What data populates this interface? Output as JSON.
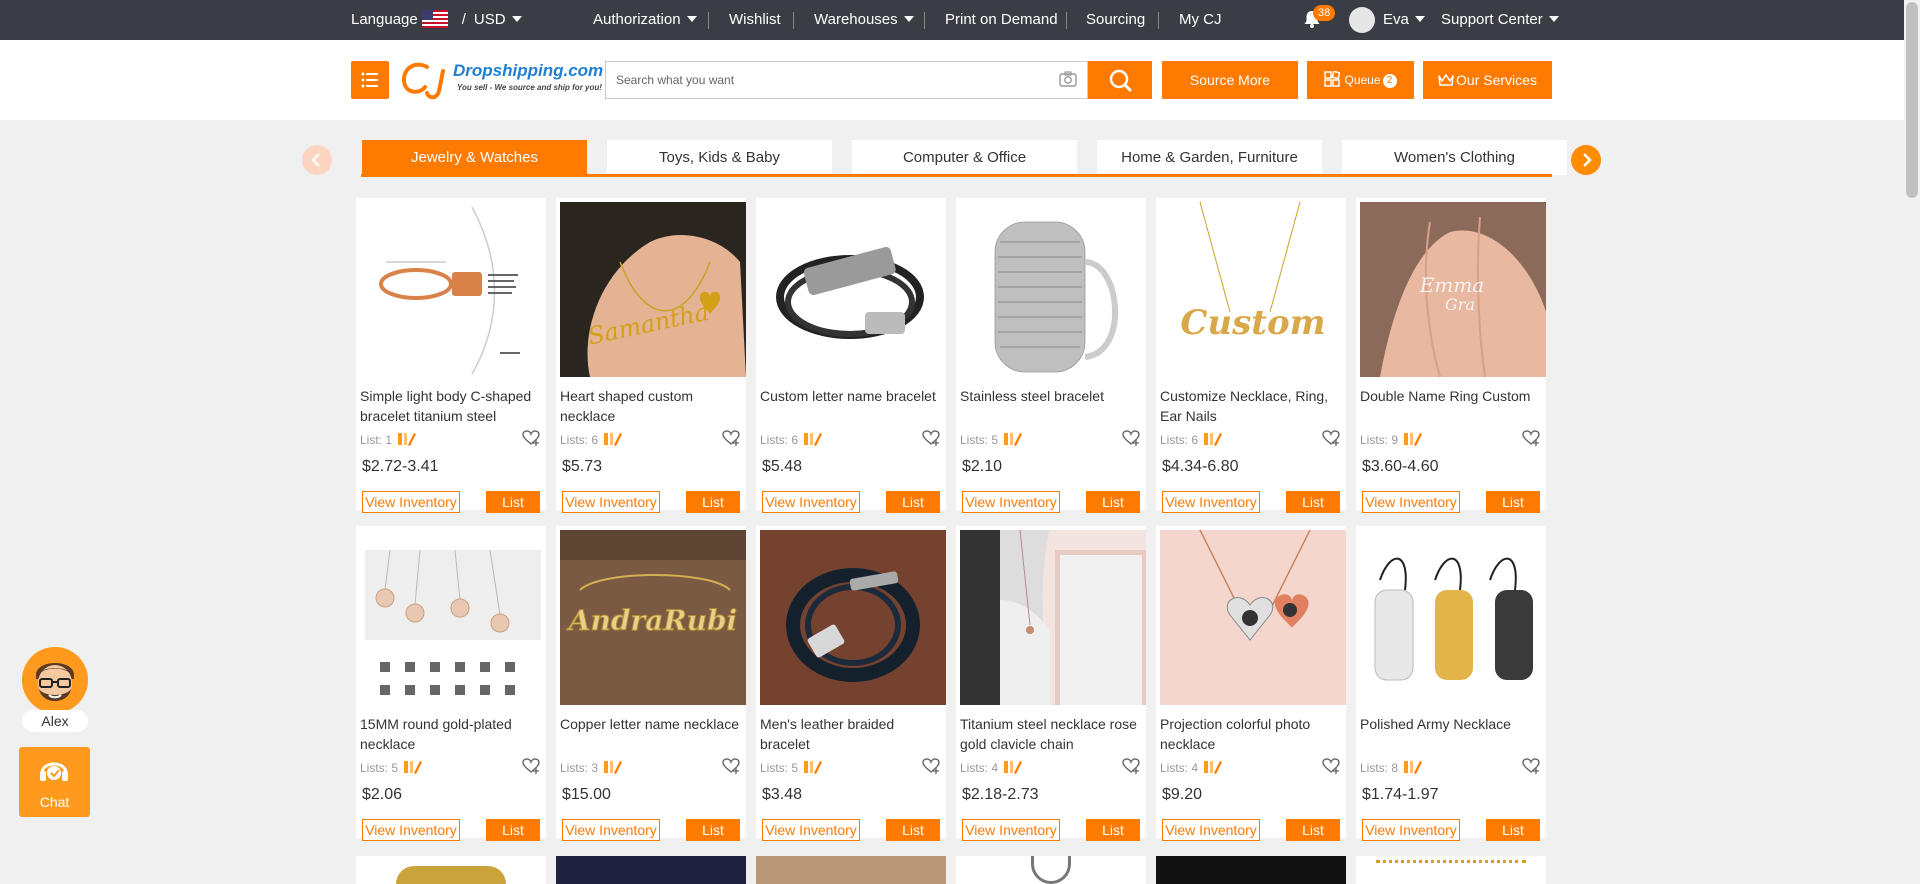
{
  "topbar": {
    "language_label": "Language",
    "slash": "/",
    "currency": "USD",
    "nav": [
      "Authorization",
      "Wishlist",
      "Warehouses",
      "Print on Demand",
      "Sourcing",
      "My CJ"
    ],
    "notification_count": "38",
    "user_name": "Eva",
    "support_center": "Support Center"
  },
  "header": {
    "logo_text": "Dropshipping.com",
    "logo_tagline": "You sell - We source and ship for you!",
    "search_placeholder": "Search what you want",
    "source_more": "Source More",
    "queue_label": "Queue",
    "queue_count": "2",
    "our_services": "Our Services"
  },
  "categories": [
    {
      "label": "Jewelry & Watches",
      "active": true
    },
    {
      "label": "Toys, Kids & Baby",
      "active": false
    },
    {
      "label": "Computer & Office",
      "active": false
    },
    {
      "label": "Home & Garden, Furniture",
      "active": false
    },
    {
      "label": "Women's Clothing",
      "active": false
    }
  ],
  "products": [
    {
      "title": "Simple light body C-shaped bracelet titanium steel",
      "lists": "List: 1",
      "price": "$2.72-3.41"
    },
    {
      "title": "Heart shaped custom necklace",
      "lists": "Lists: 6",
      "price": "$5.73"
    },
    {
      "title": "Custom letter name bracelet",
      "lists": "Lists: 6",
      "price": "$5.48"
    },
    {
      "title": "Stainless steel bracelet",
      "lists": "Lists: 5",
      "price": "$2.10"
    },
    {
      "title": "Customize Necklace, Ring, Ear Nails",
      "lists": "Lists: 6",
      "price": "$4.34-6.80"
    },
    {
      "title": "Double Name Ring Custom",
      "lists": "Lists: 9",
      "price": "$3.60-4.60"
    },
    {
      "title": "15MM round gold-plated necklace",
      "lists": "Lists: 5",
      "price": "$2.06"
    },
    {
      "title": "Copper letter name necklace",
      "lists": "Lists: 3",
      "price": "$15.00"
    },
    {
      "title": "Men's leather braided bracelet",
      "lists": "Lists: 5",
      "price": "$3.48"
    },
    {
      "title": "Titanium steel necklace rose gold clavicle chain",
      "lists": "Lists: 4",
      "price": "$2.18-2.73"
    },
    {
      "title": "Projection colorful photo necklace",
      "lists": "Lists: 4",
      "price": "$9.20"
    },
    {
      "title": "Polished Army Necklace",
      "lists": "Lists: 8",
      "price": "$1.74-1.97"
    }
  ],
  "card_buttons": {
    "view_inventory": "View Inventory",
    "list": "List"
  },
  "chat": {
    "agent_name": "Alex",
    "chat_label": "Chat"
  },
  "colors": {
    "accent": "#ff7a00",
    "topbar": "#3a3d44"
  }
}
